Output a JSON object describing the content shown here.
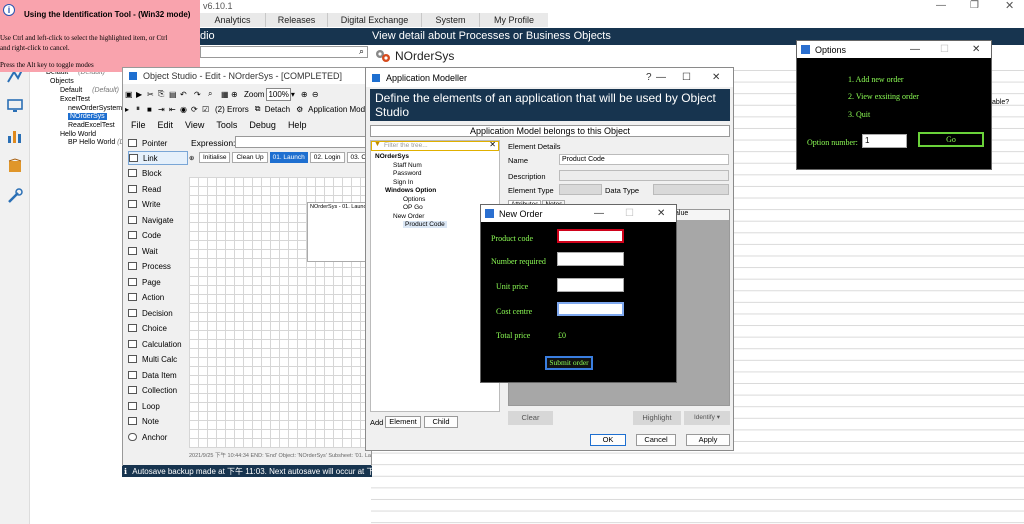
{
  "background": {
    "version": "v6.10.1",
    "menu": [
      "Analytics",
      "Releases",
      "Digital Exchange",
      "System",
      "My Profile"
    ],
    "bluebar_left": "dio",
    "bluebar_right": "View detail about Processes or Business Objects",
    "object_name": "NOrderSys",
    "right_fragment": "able?",
    "tree": {
      "default1": "Default",
      "default1_tag": "(Default)",
      "objects": "Objects",
      "default2": "Default",
      "default2_tag": "(Default)",
      "exceltest": "ExcelTest",
      "neworder": "newOrderSystem",
      "nordersys": "NOrderSys",
      "readexcel": "ReadExcelTest",
      "hello": "Hello World",
      "bp_hello": "BP Hello World",
      "bp_tag": "(De"
    }
  },
  "tooltip": {
    "title": "Using the Identification Tool - (Win32 mode)",
    "line1": "Use Ctrl and left-click to select the highlighted item, or Ctrl",
    "line2": "and right-click to cancel.",
    "line3": "Press the Alt key to toggle modes"
  },
  "object_studio": {
    "title": "Object Studio - Edit - NOrderSys - [COMPLETED]",
    "errors": "(2) Errors",
    "detach": "Detach",
    "app_modeller": "Application Mod",
    "zoom_label": "Zoom",
    "zoom_value": "100%",
    "menu": [
      "File",
      "Edit",
      "View",
      "Tools",
      "Debug",
      "Help"
    ],
    "expression_label": "Expression:",
    "tabs": [
      "Initialise",
      "Clean Up",
      "01. Launch",
      "02. Login",
      "03. O"
    ],
    "stage_label": "NOrderSys - 01. Launch",
    "panel": [
      "Pointer",
      "Link",
      "Block",
      "Read",
      "Write",
      "Navigate",
      "Code",
      "Wait",
      "Process",
      "Page",
      "Action",
      "Decision",
      "Choice",
      "Calculation",
      "Multi Calc",
      "Data Item",
      "Collection",
      "Loop",
      "Note",
      "Anchor"
    ],
    "log": "2021/9/25 下午 10:44:34 END: 'End' Object: 'NOrderSys' Subsheet: '01. Launch'",
    "status": "Autosave backup made at 下午 11:03. Next autosave will occur at 下午 11:13."
  },
  "app_modeller": {
    "title": "Application Modeller",
    "help": "?",
    "banner": "Define the elements of an application that will be used by Object Studio",
    "belongs": "Application Model belongs to this Object",
    "filter_placeholder": "Filter the tree...",
    "tree": {
      "root": "NOrderSys",
      "staff": "Staff Num",
      "password": "Password",
      "signin": "Sign In",
      "winopt": "Windows Option",
      "options": "Options",
      "opgo": "OP Go",
      "neworder": "New Order",
      "productcode": "Product Code"
    },
    "element_details": "Element Details",
    "name_label": "Name",
    "name_value": "Product Code",
    "description_label": "Description",
    "element_type_label": "Element Type",
    "data_type_label": "Data Type",
    "tabs": [
      "Attributes",
      "Notes"
    ],
    "value_header": "alue",
    "add_label": "Add",
    "element_btn": "Element",
    "child_btn": "Child",
    "clear_btn": "Clear",
    "highlight_btn": "Highlight",
    "identify_btn": "Identify",
    "ok_btn": "OK",
    "cancel_btn": "Cancel",
    "apply_btn": "Apply"
  },
  "new_order": {
    "title": "New Order",
    "product_code": "Product code",
    "number_required": "Number required",
    "unit_price": "Unit price",
    "cost_centre": "Cost centre",
    "total_price": "Total price",
    "total_value": "£0",
    "submit": "Submit order"
  },
  "options": {
    "title": "Options",
    "item1": "1. Add new order",
    "item2": "2. View exsiting order",
    "item3": "3. Quit",
    "number_label": "Option number:",
    "number_value": "1",
    "go": "Go"
  },
  "colors": {
    "navy": "#17344f",
    "terminal_green": "#8dff55",
    "tooltip_pink": "#f9a3ad",
    "focus_red": "#d0021b",
    "highlight_blue": "#1e6fd0"
  }
}
